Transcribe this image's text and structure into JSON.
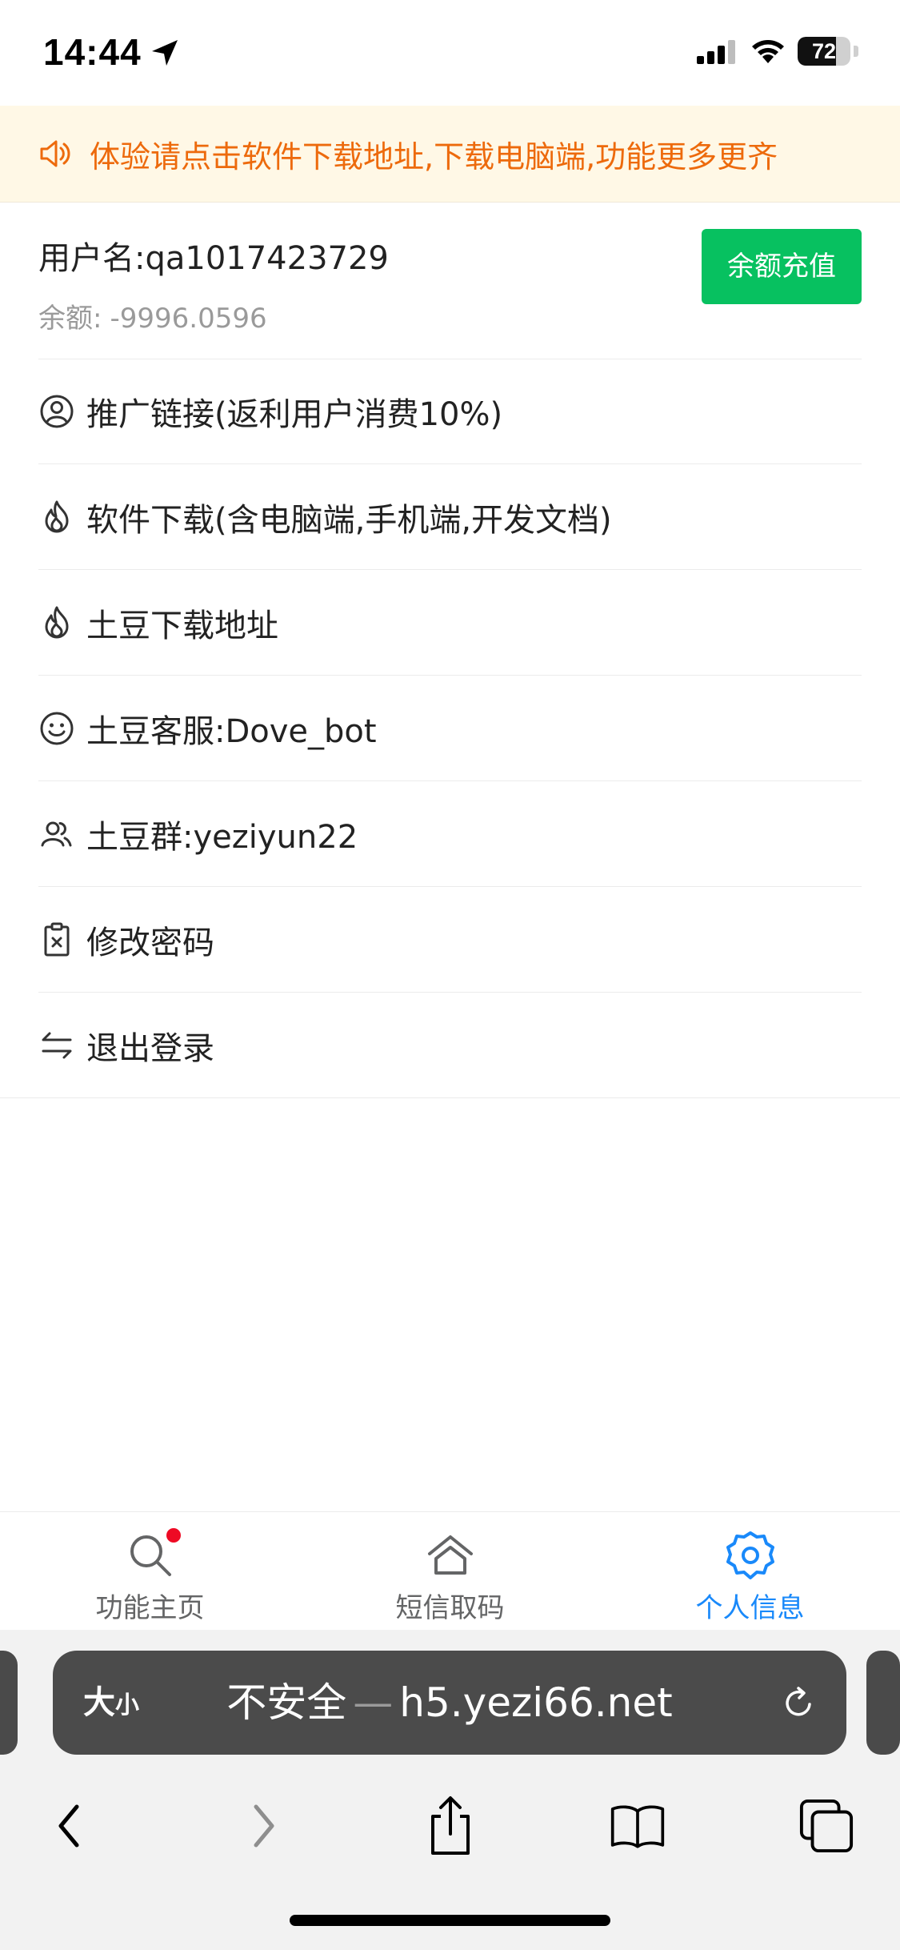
{
  "status_bar": {
    "time": "14:44",
    "battery": "72",
    "battery_level": 0.72
  },
  "notice": {
    "text": "体验请点击软件下载地址,下载电脑端,功能更多更齐",
    "color": "#ed6a0c"
  },
  "user": {
    "username_label": "用户名:qa1017423729",
    "balance_label": "余额:",
    "balance_value": "-9996.0596",
    "recharge_label": "余额充值"
  },
  "menu": {
    "items": [
      {
        "label": "推广链接(返利用户消费10%)",
        "icon": "user-circle-icon"
      },
      {
        "label": "软件下载(含电脑端,手机端,开发文档)",
        "icon": "fire-icon"
      },
      {
        "label": "土豆下载地址",
        "icon": "fire-icon"
      },
      {
        "label": "土豆客服:Dove_bot",
        "icon": "smile-icon"
      },
      {
        "label": "土豆群:yeziyun22",
        "icon": "friends-icon"
      },
      {
        "label": "修改密码",
        "icon": "clipboard-x-icon"
      },
      {
        "label": "退出登录",
        "icon": "exchange-icon"
      }
    ]
  },
  "tabbar": {
    "tabs": [
      {
        "label": "功能主页",
        "icon": "search-icon",
        "active": false,
        "badge_dot": true
      },
      {
        "label": "短信取码",
        "icon": "home-icon",
        "active": false
      },
      {
        "label": "个人信息",
        "icon": "settings-icon",
        "active": true
      }
    ],
    "active_color": "#1989fa"
  },
  "browser": {
    "text_size_label": "大",
    "text_size_small": "小",
    "security_label": "不安全",
    "separator": "—",
    "domain": "h5.yezi66.net"
  },
  "colors": {
    "primary_green": "#07c160",
    "notice_bg": "#fff8e6"
  }
}
